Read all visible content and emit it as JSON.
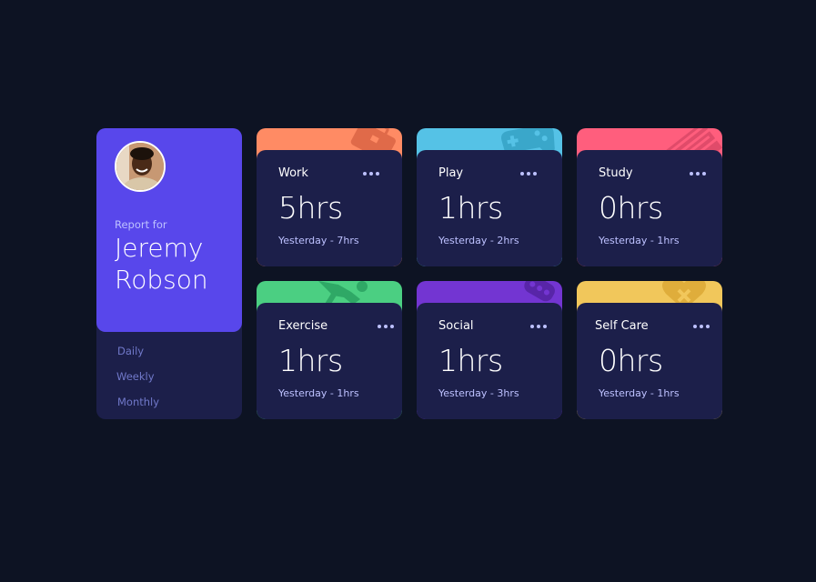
{
  "profile": {
    "report_label": "Report for",
    "first_name": "Jeremy",
    "last_name": "Robson",
    "periods": [
      "Daily",
      "Weekly",
      "Monthly"
    ]
  },
  "cards": [
    {
      "title": "Work",
      "hours": "5hrs",
      "previous": "Yesterday - 7hrs",
      "color": "#ff8b64",
      "icon": "briefcase-icon"
    },
    {
      "title": "Play",
      "hours": "1hrs",
      "previous": "Yesterday - 2hrs",
      "color": "#55c2e6",
      "icon": "gamepad-icon"
    },
    {
      "title": "Study",
      "hours": "0hrs",
      "previous": "Yesterday - 1hrs",
      "color": "#ff5e7d",
      "icon": "books-icon"
    },
    {
      "title": "Exercise",
      "hours": "1hrs",
      "previous": "Yesterday - 1hrs",
      "color": "#4bcf82",
      "icon": "running-icon"
    },
    {
      "title": "Social",
      "hours": "1hrs",
      "previous": "Yesterday - 3hrs",
      "color": "#7335d2",
      "icon": "chat-icon"
    },
    {
      "title": "Self Care",
      "hours": "0hrs",
      "previous": "Yesterday - 1hrs",
      "color": "#f1c75b",
      "icon": "heart-icon"
    }
  ]
}
